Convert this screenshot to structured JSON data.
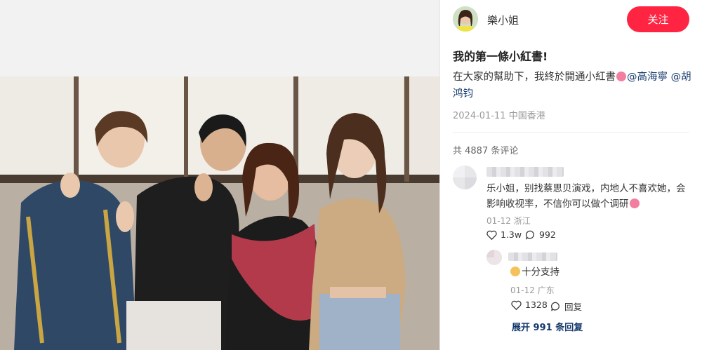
{
  "author": {
    "name": "樂小姐",
    "follow_label": "关注"
  },
  "post": {
    "title": "我的第一條小紅書!",
    "desc_main": "在大家的幫助下，我終於開通小紅書",
    "mention_1": "@高海寧",
    "mention_2": "@胡鸿钧",
    "date": "2024-01-11",
    "location": "中国香港"
  },
  "comments": {
    "count_label": "共 4887 条评论",
    "items": [
      {
        "text": "乐小姐，别找蔡思贝演戏，内地人不喜欢她，会影响收视率，不信你可以做个调研",
        "date": "01-12",
        "region": "浙江",
        "likes": "1.3w",
        "replies": "992"
      }
    ],
    "reply": {
      "text": "十分支持",
      "date": "01-12",
      "region": "广东",
      "likes": "1328",
      "reply_label": "回复"
    },
    "expand_label": "展开 991 条回复"
  },
  "colors": {
    "accent": "#ff2442",
    "mention": "#13386c",
    "muted": "#999999"
  },
  "icons": [
    "heart-icon",
    "comment-bubble-icon",
    "emoji-icon"
  ]
}
